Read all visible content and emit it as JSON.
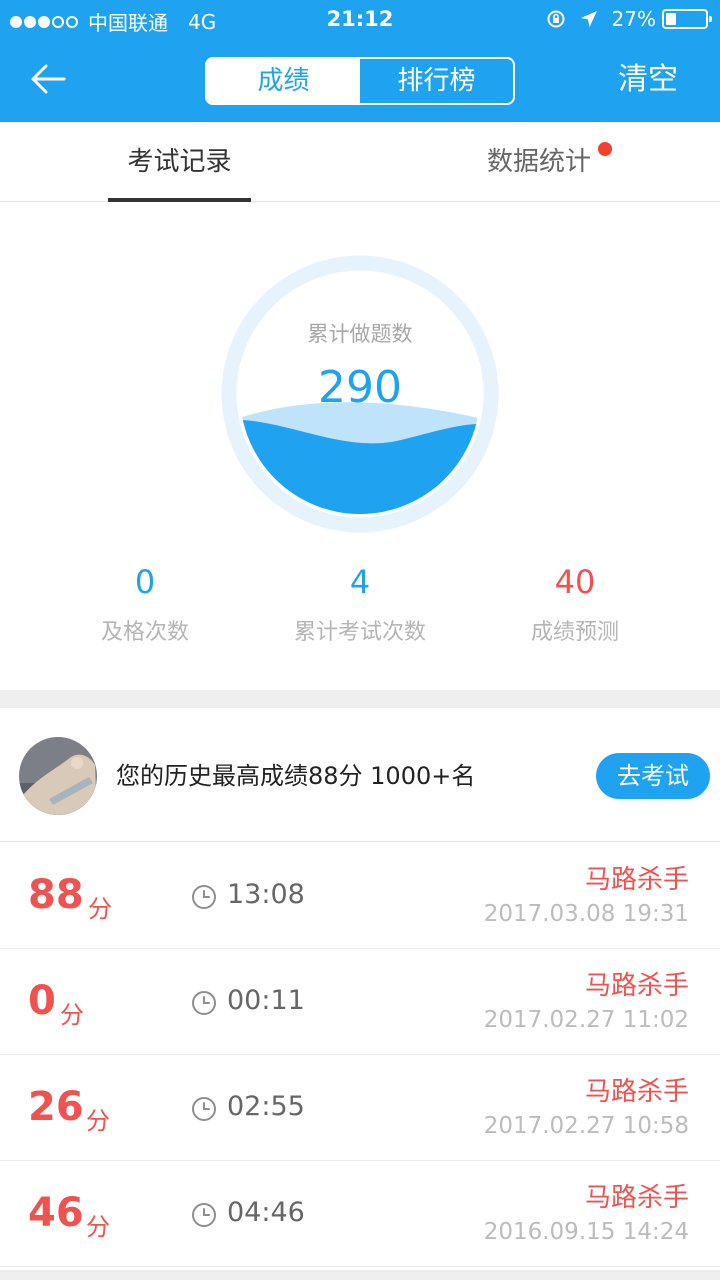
{
  "status": {
    "carrier": "中国联通",
    "network": "4G",
    "time": "21:12",
    "battery": "27%",
    "battery_level": 0.27
  },
  "header": {
    "segments": [
      "成绩",
      "排行榜"
    ],
    "clear_label": "清空"
  },
  "tabs": [
    "考试记录",
    "数据统计"
  ],
  "gauge": {
    "title": "累计做题数",
    "value": "290"
  },
  "stats": [
    {
      "value": "0",
      "label": "及格次数"
    },
    {
      "value": "4",
      "label": "累计考试次数"
    },
    {
      "value": "40",
      "label": "成绩预测"
    }
  ],
  "best": {
    "text": "您的历史最高成绩88分 1000+名",
    "button": "去考试"
  },
  "records": [
    {
      "score": "88",
      "unit": "分",
      "duration": "13:08",
      "name": "马路杀手",
      "date": "2017.03.08 19:31"
    },
    {
      "score": "0",
      "unit": "分",
      "duration": "00:11",
      "name": "马路杀手",
      "date": "2017.02.27 11:02"
    },
    {
      "score": "26",
      "unit": "分",
      "duration": "02:55",
      "name": "马路杀手",
      "date": "2017.02.27 10:58"
    },
    {
      "score": "46",
      "unit": "分",
      "duration": "04:46",
      "name": "马路杀手",
      "date": "2016.09.15 14:24"
    }
  ],
  "colors": {
    "brand": "#1fa3f0",
    "score_red": "#ef5350",
    "badge_red": "#f4402c"
  },
  "icons": [
    "back-arrow-icon",
    "location-lock-icon",
    "location-arrow-icon",
    "battery-icon",
    "clock-icon"
  ]
}
